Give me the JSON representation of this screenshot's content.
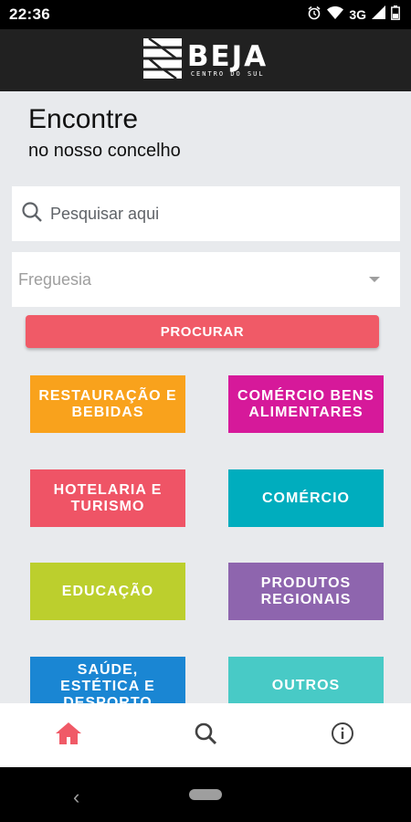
{
  "status_bar": {
    "time": "22:36",
    "network": "3G"
  },
  "header": {
    "logo_title": "BEJA",
    "logo_subtitle": "CENTRO DO SUL"
  },
  "main": {
    "title": "Encontre",
    "subtitle": "no nosso concelho",
    "search": {
      "placeholder": "Pesquisar aqui",
      "value": ""
    },
    "parish_select": {
      "selected": "Freguesia"
    },
    "search_button": "PROCURAR"
  },
  "categories": [
    {
      "label": "RESTAURAÇÃO E BEBIDAS",
      "color": "#f9a21c"
    },
    {
      "label": "COMÉRCIO BENS ALIMENTARES",
      "color": "#d6199a"
    },
    {
      "label": "HOTELARIA E TURISMO",
      "color": "#ef5466"
    },
    {
      "label": "COMÉRCIO",
      "color": "#00adbe"
    },
    {
      "label": "EDUCAÇÃO",
      "color": "#bccf2d"
    },
    {
      "label": "PRODUTOS REGIONAIS",
      "color": "#8e65ae"
    },
    {
      "label": "SAÚDE, ESTÉTICA E DESPORTO",
      "color": "#1a86d3"
    },
    {
      "label": "OUTROS",
      "color": "#48cac6"
    }
  ],
  "bottom_nav": [
    {
      "icon": "home-icon",
      "active": true
    },
    {
      "icon": "search-icon",
      "active": false
    },
    {
      "icon": "info-icon",
      "active": false
    }
  ],
  "colors": {
    "accent": "#f05a67",
    "header": "#212121",
    "background": "#e8eaed"
  }
}
